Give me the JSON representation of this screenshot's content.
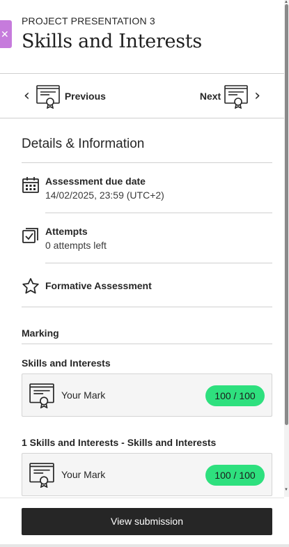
{
  "header": {
    "project_label": "PROJECT PRESENTATION 3",
    "title": "Skills and Interests"
  },
  "close_tab": {
    "icon": "close-icon",
    "glyph": "✕",
    "color": "#c67bdc"
  },
  "nav": {
    "previous_label": "Previous",
    "next_label": "Next",
    "icon": "certificate-icon"
  },
  "details": {
    "section_title": "Details & Information",
    "items": [
      {
        "icon": "calendar-icon",
        "title": "Assessment due date",
        "subtitle": "14/02/2025, 23:59 (UTC+2)"
      },
      {
        "icon": "attempts-icon",
        "title": "Attempts",
        "subtitle": "0 attempts left"
      },
      {
        "icon": "star-icon",
        "title": "Formative Assessment",
        "subtitle": ""
      }
    ]
  },
  "marking": {
    "section_label": "Marking",
    "entries": [
      {
        "heading": "Skills and Interests",
        "mark_label": "Your Mark",
        "score": "100 / 100"
      },
      {
        "heading": "1 Skills and Interests - Skills and Interests",
        "mark_label": "Your Mark",
        "score": "100 / 100"
      }
    ],
    "badge_color": "#2ee07e"
  },
  "footer": {
    "view_submission_label": "View submission"
  }
}
